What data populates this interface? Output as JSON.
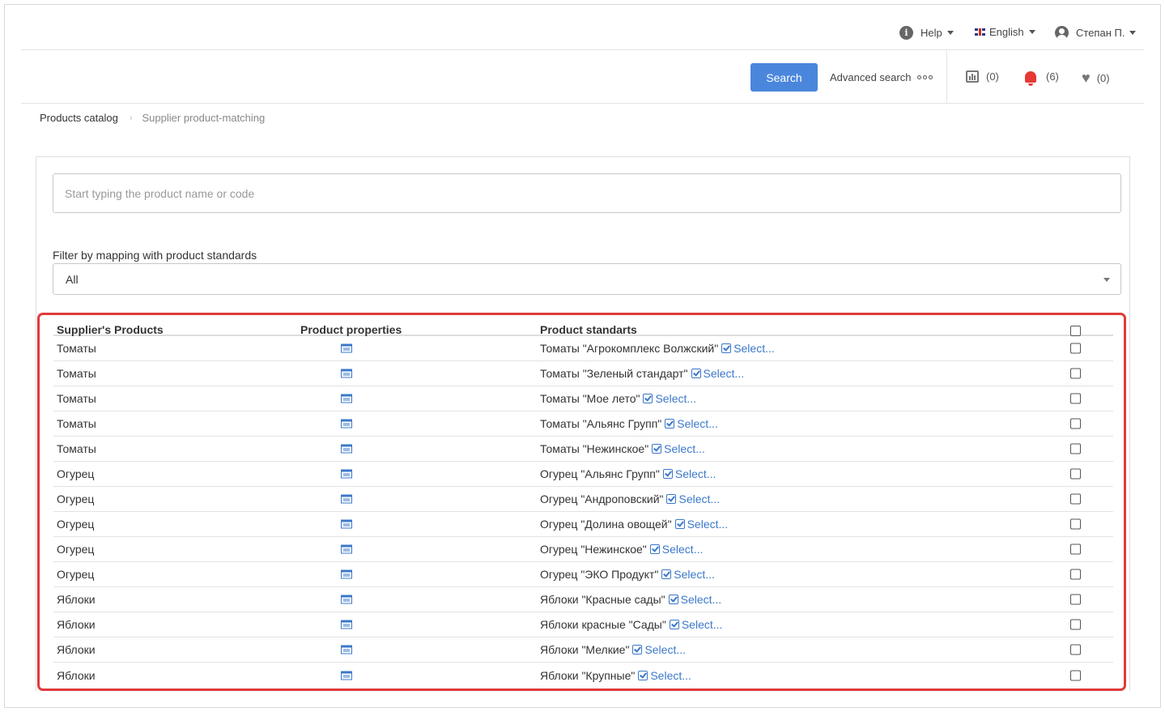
{
  "topbar": {
    "help_label": "Help",
    "language_label": "English",
    "user_label": "Степан П."
  },
  "searchbar": {
    "search_button": "Search",
    "advanced_search": "Advanced search",
    "compare_count": "(0)",
    "notifications_count": "(6)",
    "favorites_count": "(0)"
  },
  "breadcrumb": {
    "items": [
      "Products catalog",
      "Supplier product-matching"
    ]
  },
  "filters": {
    "product_search_placeholder": "Start typing the product name or code",
    "mapping_filter_label": "Filter by mapping with product standards",
    "mapping_filter_value": "All"
  },
  "table": {
    "headers": {
      "supplier_products": "Supplier's Products",
      "product_properties": "Product properties",
      "product_standards": "Product standarts"
    },
    "select_link": "Select...",
    "rows": [
      {
        "product": "Томаты",
        "standard": "Томаты \"Агрокомплекс Волжский\""
      },
      {
        "product": "Томаты",
        "standard": "Томаты \"Зеленый стандарт\""
      },
      {
        "product": "Томаты",
        "standard": "Томаты \"Мое лето\""
      },
      {
        "product": "Томаты",
        "standard": "Томаты \"Альянс Групп\""
      },
      {
        "product": "Томаты",
        "standard": "Томаты \"Нежинское\""
      },
      {
        "product": "Огурец",
        "standard": "Огурец \"Альянс Групп\""
      },
      {
        "product": "Огурец",
        "standard": "Огурец \"Андроповский\""
      },
      {
        "product": "Огурец",
        "standard": "Огурец \"Долина овощей\""
      },
      {
        "product": "Огурец",
        "standard": "Огурец \"Нежинское\""
      },
      {
        "product": "Огурец",
        "standard": "Огурец \"ЭКО Продукт\""
      },
      {
        "product": "Яблоки",
        "standard": "Яблоки \"Красные сады\""
      },
      {
        "product": "Яблоки",
        "standard": "Яблоки красные \"Сады\""
      },
      {
        "product": "Яблоки",
        "standard": "Яблоки \"Мелкие\""
      },
      {
        "product": "Яблоки",
        "standard": "Яблоки \"Крупные\""
      }
    ]
  },
  "colors": {
    "primary": "#4a86dc",
    "link": "#3b78c9",
    "highlight_border": "#e03a3a",
    "notification": "#e53935"
  }
}
